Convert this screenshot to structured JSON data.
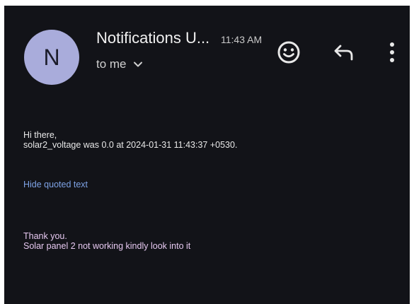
{
  "header": {
    "avatar_letter": "N",
    "sender": "Notifications U...",
    "time": "11:43 AM",
    "recipient": "to me"
  },
  "icons": {
    "emoji": "smiley-face-icon",
    "reply": "reply-arrow-icon",
    "more": "vertical-dots-icon",
    "expand": "chevron-down-icon"
  },
  "message": {
    "greeting": "Hi there,",
    "alert": "solar2_voltage was 0.0 at 2024-01-31 11:43:37 +0530.",
    "hide_quoted": "Hide quoted text",
    "thanks": "Thank you.",
    "note": "Solar panel 2 not working kindly look into it"
  },
  "colors": {
    "background": "#121318",
    "avatar": "#a9acdb",
    "link": "#7ea3e6",
    "quoted_text": "#e6c8f0"
  }
}
